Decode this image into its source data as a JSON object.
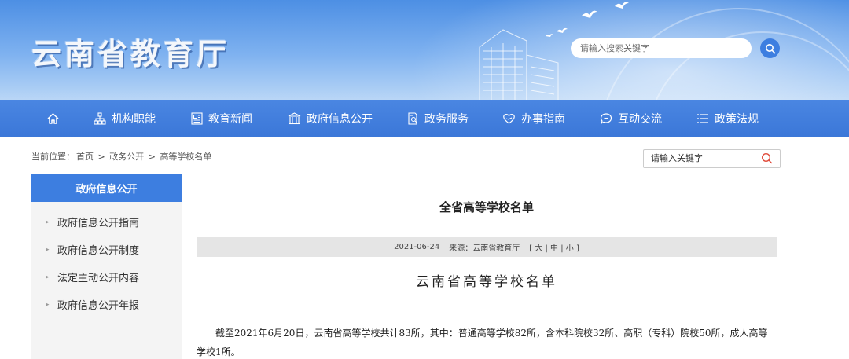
{
  "header": {
    "site_title": "云南省教育厅",
    "search_placeholder": "请输入搜索关键字"
  },
  "nav": {
    "items": [
      {
        "label": "",
        "icon": "home-icon"
      },
      {
        "label": "机构职能",
        "icon": "org-chart-icon"
      },
      {
        "label": "教育新闻",
        "icon": "newspaper-icon"
      },
      {
        "label": "政府信息公开",
        "icon": "government-building-icon"
      },
      {
        "label": "政务服务",
        "icon": "document-search-icon"
      },
      {
        "label": "办事指南",
        "icon": "heart-hand-icon"
      },
      {
        "label": "互动交流",
        "icon": "chat-bubble-icon"
      },
      {
        "label": "政策法规",
        "icon": "list-icon"
      }
    ]
  },
  "breadcrumb": {
    "prefix": "当前位置：",
    "items": [
      "首页",
      "政务公开",
      "高等学校名单"
    ],
    "separator": ">"
  },
  "side_search": {
    "placeholder": "请输入关键字"
  },
  "sidebar": {
    "heading": "政府信息公开",
    "items": [
      {
        "label": "政府信息公开指南"
      },
      {
        "label": "政府信息公开制度"
      },
      {
        "label": "法定主动公开内容"
      },
      {
        "label": "政府信息公开年报"
      }
    ]
  },
  "article": {
    "title": "全省高等学校名单",
    "date": "2021-06-24",
    "source": "来源：云南省教育厅",
    "font_size_label": "[ 大 | 中 | 小 ]",
    "doc_title": "云南省高等学校名单",
    "body": "截至2021年6月20日，云南省高等学校共计83所，其中：普通高等学校82所，含本科院校32所、高职（专科）院校50所，成人高等学校1所。"
  },
  "colors": {
    "primary": "#3d7ee0",
    "nav_bg": "#4a86e2",
    "sidebar_bg": "#f4f4f4",
    "meta_bg": "#e5e5e5"
  }
}
